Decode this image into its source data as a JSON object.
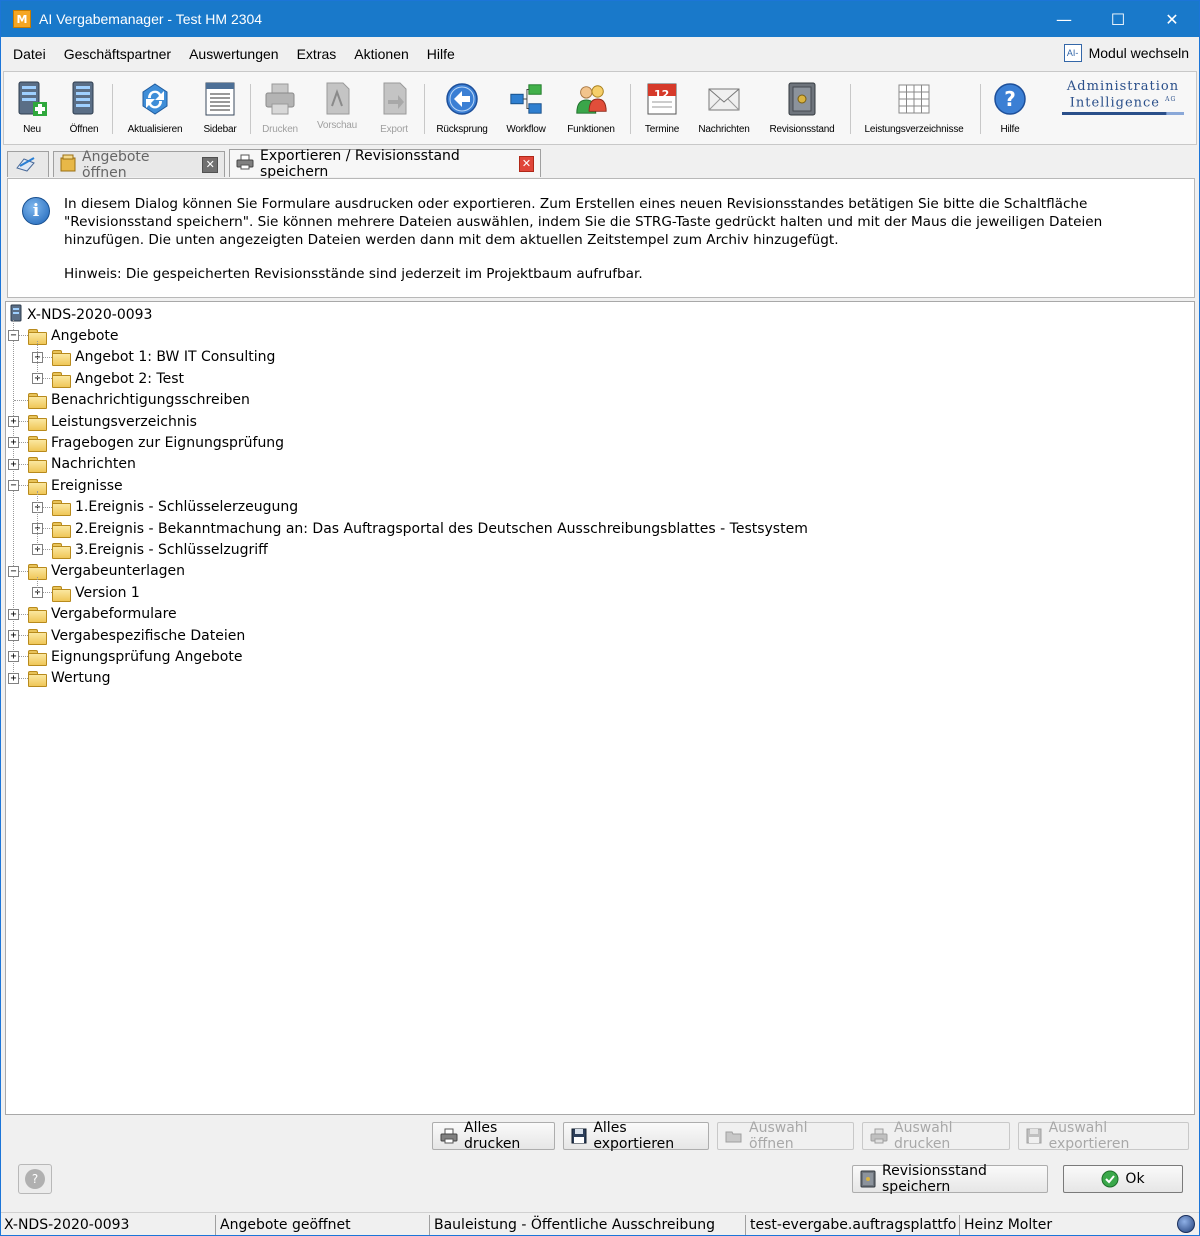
{
  "window": {
    "title": "AI Vergabemanager - Test HM 2304",
    "app_icon_letter": "M",
    "minimize": "—",
    "maximize": "☐",
    "close": "✕"
  },
  "menu": {
    "items": [
      "Datei",
      "Geschäftspartner",
      "Auswertungen",
      "Extras",
      "Aktionen",
      "Hilfe"
    ],
    "modul_icon": "AI-",
    "modul_label": "Modul wechseln"
  },
  "toolbar": {
    "buttons": [
      {
        "label": "Neu",
        "icon": "server-add-icon",
        "enabled": true
      },
      {
        "label": "Öffnen",
        "icon": "server-open-icon",
        "enabled": true
      },
      {
        "label": "Aktualisieren",
        "icon": "refresh-icon",
        "enabled": true
      },
      {
        "label": "Sidebar",
        "icon": "sidebar-icon",
        "enabled": true
      },
      {
        "label": "Drucken",
        "icon": "printer-icon",
        "enabled": false
      },
      {
        "label": "Vorschau",
        "icon": "preview-icon",
        "enabled": false
      },
      {
        "label": "Export",
        "icon": "export-icon",
        "enabled": false
      },
      {
        "label": "Rücksprung",
        "icon": "back-arrow-icon",
        "enabled": true
      },
      {
        "label": "Workflow",
        "icon": "workflow-icon",
        "enabled": true
      },
      {
        "label": "Funktionen",
        "icon": "functions-icon",
        "enabled": true
      },
      {
        "label": "Termine",
        "icon": "calendar-icon",
        "enabled": true
      },
      {
        "label": "Nachrichten",
        "icon": "envelope-icon",
        "enabled": true
      },
      {
        "label": "Revisionsstand",
        "icon": "safe-icon",
        "enabled": true
      },
      {
        "label": "Leistungsverzeichnisse",
        "icon": "grid-icon",
        "enabled": true
      },
      {
        "label": "Hilfe",
        "icon": "help-icon",
        "enabled": true
      }
    ],
    "calendar_day": "12",
    "brand_line1": "Administration",
    "brand_line2": "Intelligence",
    "brand_suffix": "AG"
  },
  "tabs": [
    {
      "label": "",
      "icon": "home-icon"
    },
    {
      "label": "Angebote öffnen",
      "icon": "box-icon"
    },
    {
      "label": "Exportieren / Revisionsstand speichern",
      "icon": "printer-icon"
    }
  ],
  "info": {
    "text": "In diesem Dialog können Sie Formulare ausdrucken oder exportieren. Zum Erstellen eines neuen Revisionsstandes betätigen Sie bitte die Schaltfläche \"Revisionsstand speichern\". Sie können mehrere Dateien auswählen, indem Sie die STRG-Taste gedrückt halten und mit der Maus die jeweiligen Dateien hinzufügen. Die unten angezeigten Dateien werden dann mit dem aktuellen Zeitstempel zum Archiv hinzugefügt.",
    "hint": "Hinweis: Die gespeicherten Revisionsstände sind jederzeit im Projektbaum aufrufbar."
  },
  "tree": {
    "root": "X-NDS-2020-0093",
    "nodes": [
      {
        "label": "Angebote",
        "level": 1,
        "expander": "−"
      },
      {
        "label": "Angebot 1: BW IT Consulting",
        "level": 2,
        "expander": "+"
      },
      {
        "label": "Angebot 2: Test",
        "level": 2,
        "expander": "+"
      },
      {
        "label": "Benachrichtigungsschreiben",
        "level": 1,
        "expander": ""
      },
      {
        "label": "Leistungsverzeichnis",
        "level": 1,
        "expander": "+"
      },
      {
        "label": "Fragebogen zur Eignungsprüfung",
        "level": 1,
        "expander": "+"
      },
      {
        "label": "Nachrichten",
        "level": 1,
        "expander": "+"
      },
      {
        "label": "Ereignisse",
        "level": 1,
        "expander": "−"
      },
      {
        "label": "1.Ereignis - Schlüsselerzeugung",
        "level": 2,
        "expander": "+"
      },
      {
        "label": "2.Ereignis - Bekanntmachung an: Das Auftragsportal des Deutschen Ausschreibungsblattes - Testsystem",
        "level": 2,
        "expander": "+"
      },
      {
        "label": "3.Ereignis - Schlüsselzugriff",
        "level": 2,
        "expander": "+"
      },
      {
        "label": "Vergabeunterlagen",
        "level": 1,
        "expander": "−"
      },
      {
        "label": "Version 1",
        "level": 2,
        "expander": "+"
      },
      {
        "label": "Vergabeformulare",
        "level": 1,
        "expander": "+"
      },
      {
        "label": "Vergabespezifische Dateien",
        "level": 1,
        "expander": "+"
      },
      {
        "label": "Eignungsprüfung Angebote",
        "level": 1,
        "expander": "+"
      },
      {
        "label": "Wertung",
        "level": 1,
        "expander": "+"
      }
    ]
  },
  "actions": {
    "print_all": "Alles drucken",
    "export_all": "Alles exportieren",
    "open_selection": "Auswahl öffnen",
    "print_selection": "Auswahl drucken",
    "export_selection": "Auswahl exportieren",
    "save_revision": "Revisionsstand speichern",
    "ok": "Ok",
    "help": "?"
  },
  "status": {
    "project": "X-NDS-2020-0093",
    "state": "Angebote geöffnet",
    "type": "Bauleistung - Öffentliche Ausschreibung",
    "server": "test-evergabe.auftragsplattfo...",
    "user": "Heinz Molter"
  }
}
